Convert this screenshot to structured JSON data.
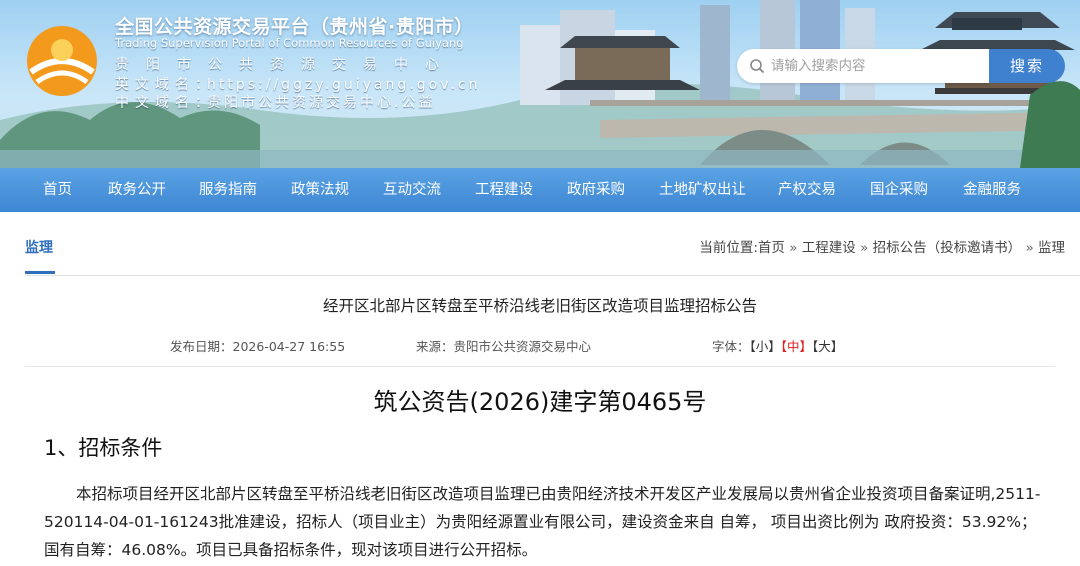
{
  "header": {
    "title_cn": "全国公共资源交易平台（贵州省·贵阳市）",
    "title_en": "Trading Supervision Portal of Common Resources of Guiyang",
    "rows": [
      {
        "key": "贵阳市公共资源交易中心",
        "value": ""
      },
      {
        "key": "英文域名：",
        "value": "https://ggzy.guiyang.gov.cn"
      },
      {
        "key": "中文域名：",
        "value": "贵阳市公共资源交易中心.公益"
      }
    ],
    "search_placeholder": "请输入搜索内容",
    "search_button": "搜索",
    "sign_text": "甲秀楼"
  },
  "nav": [
    "首页",
    "政务公开",
    "服务指南",
    "政策法规",
    "互动交流",
    "工程建设",
    "政府采购",
    "土地矿权出让",
    "产权交易",
    "国企采购",
    "金融服务"
  ],
  "breadcrumb": {
    "category": "监理",
    "prefix": "当前位置:",
    "items": [
      "首页",
      "工程建设",
      "招标公告（投标邀请书）",
      "监理"
    ],
    "separator": "»"
  },
  "article": {
    "title": "经开区北部片区转盘至平桥沿线老旧街区改造项目监理招标公告",
    "date_label": "发布日期：",
    "date": "2026-04-27 16:55",
    "source_label": "来源：",
    "source": "贵阳市公共资源交易中心",
    "font_label": "字体：",
    "font_sizes": [
      "【小】",
      "【中】",
      "【大】"
    ],
    "doc_no": "筑公资告(2026)建字第0465号",
    "section1_title": "1、招标条件",
    "section1_body": "本招标项目经开区北部片区转盘至平桥沿线老旧街区改造项目监理已由贵阳经济技术开发区产业发展局以贵州省企业投资项目备案证明,2511-520114-04-01-161243批准建设，招标人（项目业主）为贵阳经源置业有限公司，建设资金来自 自筹， 项目出资比例为 政府投资：53.92%；国有自筹：46.08%。项目已具备招标条件，现对该项目进行公开招标。"
  },
  "colors": {
    "nav": "#3d86d3",
    "accent": "#2f6fbd",
    "search_button": "#3f80cf",
    "font_active": "#e02020"
  }
}
